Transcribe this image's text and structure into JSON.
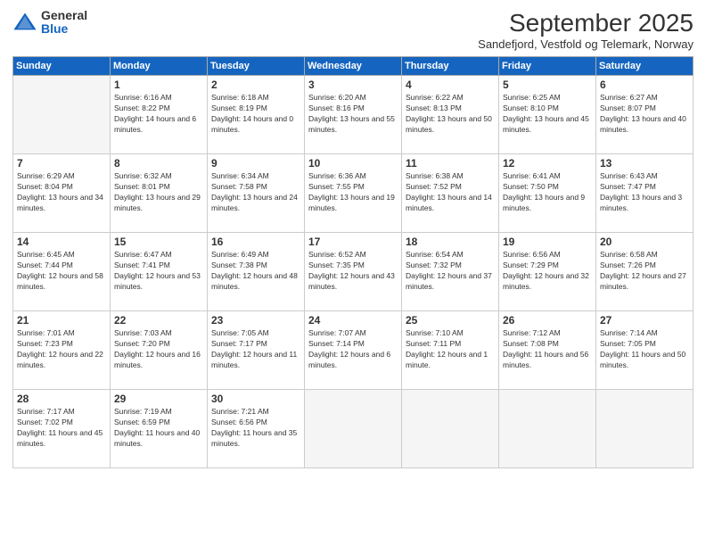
{
  "header": {
    "logo": {
      "general": "General",
      "blue": "Blue"
    },
    "title": "September 2025",
    "subtitle": "Sandefjord, Vestfold og Telemark, Norway"
  },
  "weekdays": [
    "Sunday",
    "Monday",
    "Tuesday",
    "Wednesday",
    "Thursday",
    "Friday",
    "Saturday"
  ],
  "weeks": [
    [
      {
        "day": "",
        "empty": true
      },
      {
        "day": "1",
        "sunrise": "Sunrise: 6:16 AM",
        "sunset": "Sunset: 8:22 PM",
        "daylight": "Daylight: 14 hours and 6 minutes."
      },
      {
        "day": "2",
        "sunrise": "Sunrise: 6:18 AM",
        "sunset": "Sunset: 8:19 PM",
        "daylight": "Daylight: 14 hours and 0 minutes."
      },
      {
        "day": "3",
        "sunrise": "Sunrise: 6:20 AM",
        "sunset": "Sunset: 8:16 PM",
        "daylight": "Daylight: 13 hours and 55 minutes."
      },
      {
        "day": "4",
        "sunrise": "Sunrise: 6:22 AM",
        "sunset": "Sunset: 8:13 PM",
        "daylight": "Daylight: 13 hours and 50 minutes."
      },
      {
        "day": "5",
        "sunrise": "Sunrise: 6:25 AM",
        "sunset": "Sunset: 8:10 PM",
        "daylight": "Daylight: 13 hours and 45 minutes."
      },
      {
        "day": "6",
        "sunrise": "Sunrise: 6:27 AM",
        "sunset": "Sunset: 8:07 PM",
        "daylight": "Daylight: 13 hours and 40 minutes."
      }
    ],
    [
      {
        "day": "7",
        "sunrise": "Sunrise: 6:29 AM",
        "sunset": "Sunset: 8:04 PM",
        "daylight": "Daylight: 13 hours and 34 minutes."
      },
      {
        "day": "8",
        "sunrise": "Sunrise: 6:32 AM",
        "sunset": "Sunset: 8:01 PM",
        "daylight": "Daylight: 13 hours and 29 minutes."
      },
      {
        "day": "9",
        "sunrise": "Sunrise: 6:34 AM",
        "sunset": "Sunset: 7:58 PM",
        "daylight": "Daylight: 13 hours and 24 minutes."
      },
      {
        "day": "10",
        "sunrise": "Sunrise: 6:36 AM",
        "sunset": "Sunset: 7:55 PM",
        "daylight": "Daylight: 13 hours and 19 minutes."
      },
      {
        "day": "11",
        "sunrise": "Sunrise: 6:38 AM",
        "sunset": "Sunset: 7:52 PM",
        "daylight": "Daylight: 13 hours and 14 minutes."
      },
      {
        "day": "12",
        "sunrise": "Sunrise: 6:41 AM",
        "sunset": "Sunset: 7:50 PM",
        "daylight": "Daylight: 13 hours and 9 minutes."
      },
      {
        "day": "13",
        "sunrise": "Sunrise: 6:43 AM",
        "sunset": "Sunset: 7:47 PM",
        "daylight": "Daylight: 13 hours and 3 minutes."
      }
    ],
    [
      {
        "day": "14",
        "sunrise": "Sunrise: 6:45 AM",
        "sunset": "Sunset: 7:44 PM",
        "daylight": "Daylight: 12 hours and 58 minutes."
      },
      {
        "day": "15",
        "sunrise": "Sunrise: 6:47 AM",
        "sunset": "Sunset: 7:41 PM",
        "daylight": "Daylight: 12 hours and 53 minutes."
      },
      {
        "day": "16",
        "sunrise": "Sunrise: 6:49 AM",
        "sunset": "Sunset: 7:38 PM",
        "daylight": "Daylight: 12 hours and 48 minutes."
      },
      {
        "day": "17",
        "sunrise": "Sunrise: 6:52 AM",
        "sunset": "Sunset: 7:35 PM",
        "daylight": "Daylight: 12 hours and 43 minutes."
      },
      {
        "day": "18",
        "sunrise": "Sunrise: 6:54 AM",
        "sunset": "Sunset: 7:32 PM",
        "daylight": "Daylight: 12 hours and 37 minutes."
      },
      {
        "day": "19",
        "sunrise": "Sunrise: 6:56 AM",
        "sunset": "Sunset: 7:29 PM",
        "daylight": "Daylight: 12 hours and 32 minutes."
      },
      {
        "day": "20",
        "sunrise": "Sunrise: 6:58 AM",
        "sunset": "Sunset: 7:26 PM",
        "daylight": "Daylight: 12 hours and 27 minutes."
      }
    ],
    [
      {
        "day": "21",
        "sunrise": "Sunrise: 7:01 AM",
        "sunset": "Sunset: 7:23 PM",
        "daylight": "Daylight: 12 hours and 22 minutes."
      },
      {
        "day": "22",
        "sunrise": "Sunrise: 7:03 AM",
        "sunset": "Sunset: 7:20 PM",
        "daylight": "Daylight: 12 hours and 16 minutes."
      },
      {
        "day": "23",
        "sunrise": "Sunrise: 7:05 AM",
        "sunset": "Sunset: 7:17 PM",
        "daylight": "Daylight: 12 hours and 11 minutes."
      },
      {
        "day": "24",
        "sunrise": "Sunrise: 7:07 AM",
        "sunset": "Sunset: 7:14 PM",
        "daylight": "Daylight: 12 hours and 6 minutes."
      },
      {
        "day": "25",
        "sunrise": "Sunrise: 7:10 AM",
        "sunset": "Sunset: 7:11 PM",
        "daylight": "Daylight: 12 hours and 1 minute."
      },
      {
        "day": "26",
        "sunrise": "Sunrise: 7:12 AM",
        "sunset": "Sunset: 7:08 PM",
        "daylight": "Daylight: 11 hours and 56 minutes."
      },
      {
        "day": "27",
        "sunrise": "Sunrise: 7:14 AM",
        "sunset": "Sunset: 7:05 PM",
        "daylight": "Daylight: 11 hours and 50 minutes."
      }
    ],
    [
      {
        "day": "28",
        "sunrise": "Sunrise: 7:17 AM",
        "sunset": "Sunset: 7:02 PM",
        "daylight": "Daylight: 11 hours and 45 minutes."
      },
      {
        "day": "29",
        "sunrise": "Sunrise: 7:19 AM",
        "sunset": "Sunset: 6:59 PM",
        "daylight": "Daylight: 11 hours and 40 minutes."
      },
      {
        "day": "30",
        "sunrise": "Sunrise: 7:21 AM",
        "sunset": "Sunset: 6:56 PM",
        "daylight": "Daylight: 11 hours and 35 minutes."
      },
      {
        "day": "",
        "empty": true
      },
      {
        "day": "",
        "empty": true
      },
      {
        "day": "",
        "empty": true
      },
      {
        "day": "",
        "empty": true
      }
    ]
  ]
}
